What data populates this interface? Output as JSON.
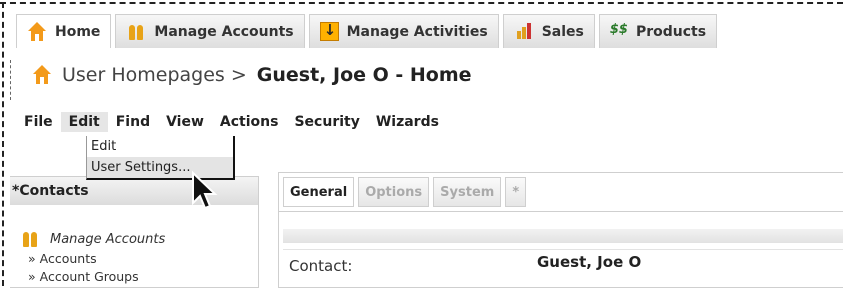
{
  "tabs": [
    {
      "label": "Home",
      "icon": "home-icon"
    },
    {
      "label": "Manage Accounts",
      "icon": "people-icon"
    },
    {
      "label": "Manage Activities",
      "icon": "activities-icon"
    },
    {
      "label": "Sales",
      "icon": "sales-icon"
    },
    {
      "label": "Products",
      "icon": "products-icon"
    }
  ],
  "breadcrumb": {
    "prefix": "User Homepages >",
    "current": "Guest, Joe O - Home"
  },
  "menu": [
    "File",
    "Edit",
    "Find",
    "View",
    "Actions",
    "Security",
    "Wizards"
  ],
  "open_menu": "Edit",
  "dropdown": [
    "Edit",
    "User Settings..."
  ],
  "dropdown_highlighted": "User Settings...",
  "left_panel": {
    "header": "*Contacts",
    "section": "Manage Accounts",
    "links": [
      "» Accounts",
      "» Account Groups"
    ]
  },
  "right_panel": {
    "tabs": [
      "General",
      "Options",
      "System",
      "*"
    ],
    "active_tab": "General",
    "field_label": "Contact:",
    "field_value": "Guest, Joe O"
  },
  "colors": {
    "accent_orange": "#f39a1a",
    "products_green": "#2a7a2a"
  }
}
